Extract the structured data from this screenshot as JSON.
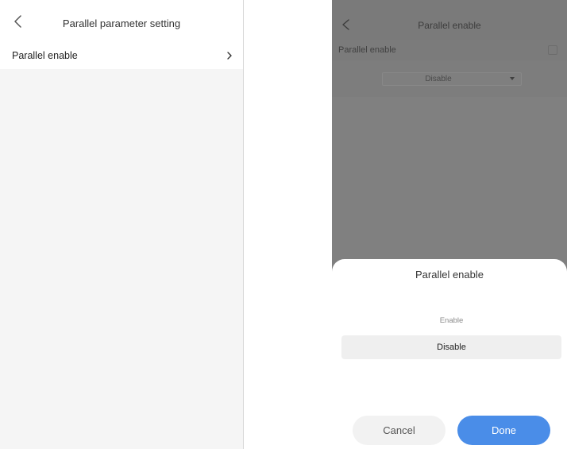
{
  "left_screen": {
    "header": {
      "title": "Parallel parameter setting",
      "back_icon": "back-chevron-icon"
    },
    "settings_item": {
      "label": "Parallel enable",
      "chevron_icon": "chevron-right-icon"
    }
  },
  "right_screen": {
    "header": {
      "title": "Parallel enable",
      "back_icon": "back-chevron-icon"
    },
    "row": {
      "label": "Parallel enable",
      "checked": false
    },
    "select": {
      "value": "Disable"
    },
    "sheet": {
      "title": "Parallel enable",
      "options": [
        "Enable",
        "Disable"
      ],
      "selected": "Disable",
      "cancel_label": "Cancel",
      "done_label": "Done"
    }
  },
  "colors": {
    "accent": "#4a8de8",
    "overlay": "#808080"
  }
}
